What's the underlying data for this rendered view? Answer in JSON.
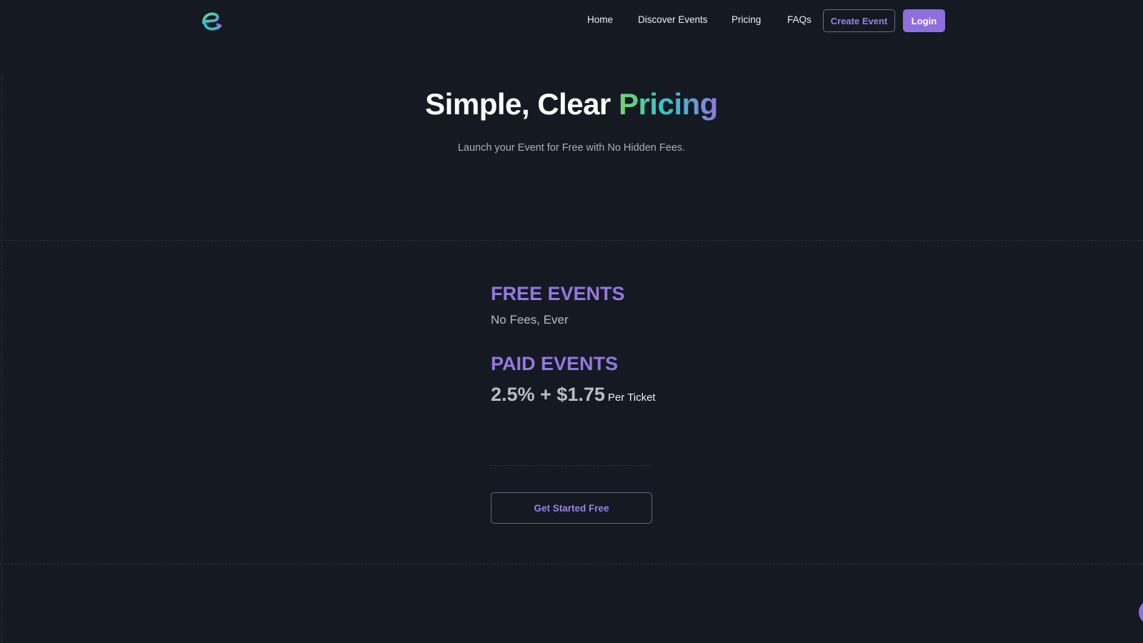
{
  "nav": {
    "logo_icon": "eventify-logo-icon",
    "links": [
      "Home",
      "Discover Events",
      "Pricing",
      "FAQs"
    ],
    "create_event_label": "Create Event",
    "login_label": "Login"
  },
  "hero": {
    "title_main": "Simple, Clear ",
    "title_accent": "Pricing",
    "subtitle": "Launch your Event for Free with No Hidden Fees."
  },
  "pricing": {
    "free": {
      "title": "FREE EVENTS",
      "note": "No Fees, Ever"
    },
    "paid": {
      "title": "PAID EVENTS",
      "amount": "2.5% + $1.75",
      "unit": "Per Ticket"
    },
    "cta_label": "Get Started Free"
  },
  "widgets": {
    "chat_icon": "chat-bubble-icon"
  },
  "colors": {
    "background": "#141922",
    "accent_purple": "#8f6fe0",
    "accent_green": "#76d36a",
    "accent_teal": "#33c7c4"
  }
}
